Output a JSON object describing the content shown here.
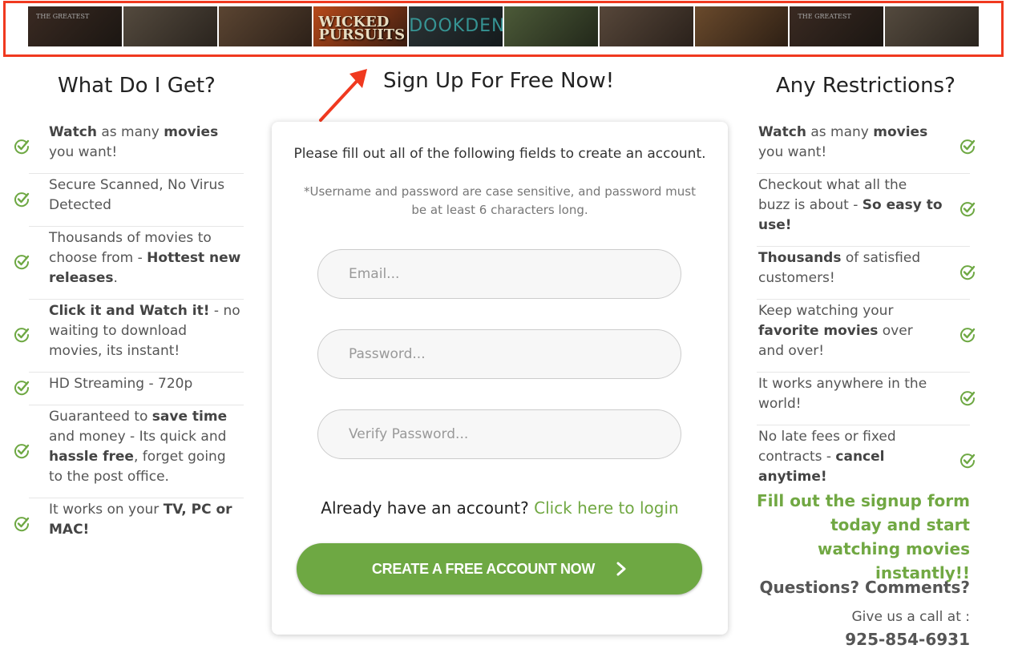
{
  "banner": {
    "posters": [
      {
        "text": "",
        "mini": "THE GREATEST",
        "colors": [
          "#3a2a22",
          "#1b1612"
        ]
      },
      {
        "text": "",
        "mini": "",
        "colors": [
          "#544a3e",
          "#2a241e"
        ]
      },
      {
        "text": "",
        "mini": "",
        "colors": [
          "#5b4532",
          "#2c2018"
        ]
      },
      {
        "text": "WICKED PURSUITS",
        "mini": "",
        "colors": [
          "#b84a1a",
          "#3a1c10"
        ]
      },
      {
        "text": "",
        "mini": "",
        "text2": "DOOKDENN",
        "colors": [
          "#2c3436",
          "#141a1c"
        ]
      },
      {
        "text": "",
        "mini": "",
        "colors": [
          "#4c5a38",
          "#22281a"
        ]
      },
      {
        "text": "",
        "mini": "",
        "colors": [
          "#57473a",
          "#2a211b"
        ]
      },
      {
        "text": "",
        "mini": "",
        "colors": [
          "#6a4a2c",
          "#2d1f14"
        ]
      },
      {
        "text": "",
        "mini": "THE GREATEST",
        "colors": [
          "#3a2a22",
          "#1b1612"
        ]
      },
      {
        "text": "",
        "mini": "",
        "colors": [
          "#544a3e",
          "#2a241e"
        ]
      }
    ],
    "border_color": "#f0391f"
  },
  "left": {
    "title": "What Do I Get?",
    "items": [
      [
        {
          "t": "Watch",
          "b": true
        },
        {
          "t": " as many "
        },
        {
          "t": "movies",
          "b": true
        },
        {
          "t": " you want!"
        }
      ],
      [
        {
          "t": "Secure Scanned, No Virus Detected"
        }
      ],
      [
        {
          "t": "Thousands of movies to choose from - "
        },
        {
          "t": "Hottest new releases",
          "b": true
        },
        {
          "t": "."
        }
      ],
      [
        {
          "t": "Click it and Watch it!",
          "b": true
        },
        {
          "t": " - no waiting to download movies, its instant!"
        }
      ],
      [
        {
          "t": "HD Streaming - 720p"
        }
      ],
      [
        {
          "t": "Guaranteed to "
        },
        {
          "t": "save time",
          "b": true
        },
        {
          "t": " and money - Its quick and "
        },
        {
          "t": "hassle free",
          "b": true
        },
        {
          "t": ", forget going to the post office."
        }
      ],
      [
        {
          "t": "It works on your "
        },
        {
          "t": "TV, PC or MAC!",
          "b": true
        }
      ]
    ]
  },
  "right": {
    "title": "Any Restrictions?",
    "items": [
      [
        {
          "t": "Watch",
          "b": true
        },
        {
          "t": " as many "
        },
        {
          "t": "movies",
          "b": true
        },
        {
          "t": " you want!"
        }
      ],
      [
        {
          "t": "Checkout what all the buzz is about - "
        },
        {
          "t": "So easy to use!",
          "b": true
        }
      ],
      [
        {
          "t": "Thousands",
          "b": true
        },
        {
          "t": " of satisfied customers!"
        }
      ],
      [
        {
          "t": "Keep watching your "
        },
        {
          "t": "favorite movies",
          "b": true
        },
        {
          "t": " over and over!"
        }
      ],
      [
        {
          "t": "It works anywhere in the world!"
        }
      ],
      [
        {
          "t": "No late fees or fixed contracts - "
        },
        {
          "t": "cancel anytime!",
          "b": true
        }
      ]
    ],
    "promo": "Fill out the signup form today and start watching movies instantly!!",
    "questions": "Questions? Comments?",
    "call": "Give us a call at :",
    "phone": "925-854-6931"
  },
  "form": {
    "title": "Sign Up For Free Now!",
    "intro": "Please fill out all of the following fields to create an account.",
    "note": "*Username and password are case sensitive, and password must be at least 6 characters long.",
    "email_placeholder": "Email...",
    "password_placeholder": "Password...",
    "verify_placeholder": "Verify Password...",
    "login_prompt": "Already have an account?",
    "login_link": "Click here to login",
    "cta_label": "CREATE A FREE ACCOUNT NOW"
  },
  "icons": {
    "check": "check-circle-icon",
    "chevron": "chevron-right-icon",
    "arrow": "arrow-up-right-icon"
  },
  "colors": {
    "accent": "#6ea843",
    "annotation": "#f0391f"
  }
}
